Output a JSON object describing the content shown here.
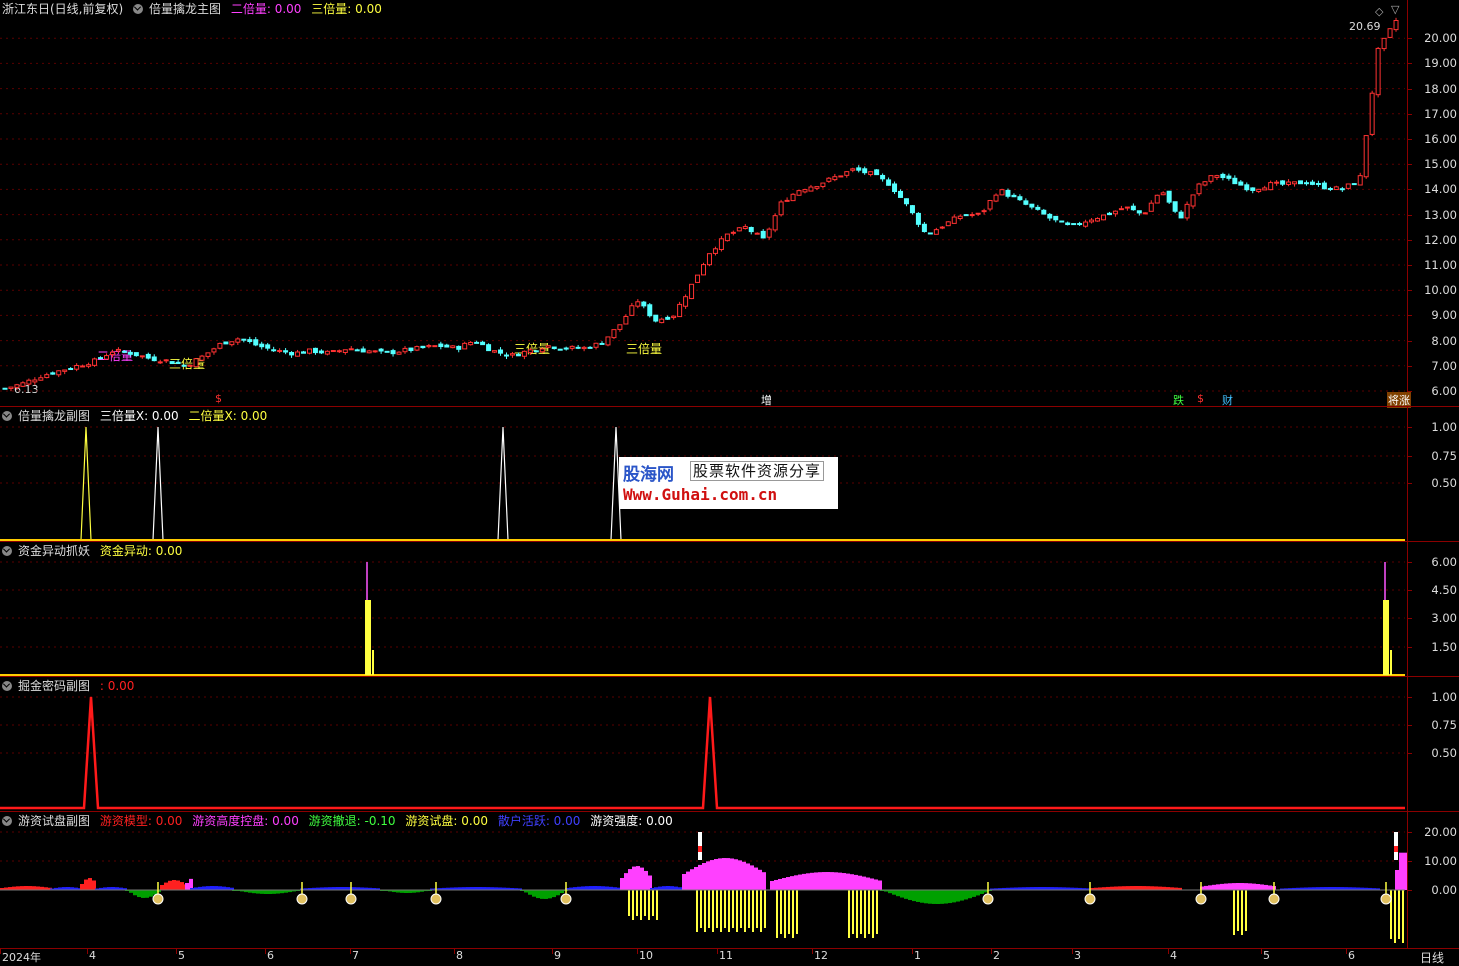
{
  "main_panel": {
    "title": "浙江东日(日线,前复权)",
    "indicator": "倍量擒龙主图",
    "fields": [
      {
        "label": "二倍量: 0.00",
        "color": "#ff40ff"
      },
      {
        "label": "三倍量: 0.00",
        "color": "#ffff40"
      }
    ],
    "high_label": "20.69",
    "low_label": "6.13",
    "y_ticks": [
      "20.00",
      "19.00",
      "18.00",
      "17.00",
      "16.00",
      "15.00",
      "14.00",
      "13.00",
      "12.00",
      "11.00",
      "10.00",
      "9.00",
      "8.00",
      "7.00",
      "6.00"
    ],
    "annotations": [
      {
        "text": "二倍量",
        "color": "#ff40ff"
      },
      {
        "text": "三倍量",
        "color": "#ffff40"
      },
      {
        "text": "三倍量",
        "color": "#ffff40"
      },
      {
        "text": "三倍量",
        "color": "#ffff40"
      }
    ],
    "signals": [
      {
        "text": "$",
        "color": "#ff3030"
      },
      {
        "text": "增",
        "color": "#ffffff"
      },
      {
        "text": "跌",
        "color": "#40ff40"
      },
      {
        "text": "$",
        "color": "#ff3030"
      },
      {
        "text": "财",
        "color": "#40c0ff"
      },
      {
        "text": "将涨",
        "color": "#ffffff"
      }
    ]
  },
  "sub1": {
    "title": "倍量擒龙副图",
    "fields": [
      {
        "label": "三倍量X: 0.00",
        "color": "#ffffff"
      },
      {
        "label": "二倍量X: 0.00",
        "color": "#ffff40"
      }
    ],
    "y_ticks": [
      "1.00",
      "0.75",
      "0.50"
    ]
  },
  "sub2": {
    "title": "资金异动抓妖",
    "fields": [
      {
        "label": "资金异动: 0.00",
        "color": "#ffff40"
      }
    ],
    "y_ticks": [
      "6.00",
      "4.50",
      "3.00",
      "1.50"
    ]
  },
  "sub3": {
    "title": "掘金密码副图",
    "fields": [
      {
        "label": ": 0.00",
        "color": "#ff2020"
      }
    ],
    "y_ticks": [
      "1.00",
      "0.75",
      "0.50"
    ]
  },
  "sub4": {
    "title": "游资试盘副图",
    "fields": [
      {
        "label": "游资模型: 0.00",
        "color": "#ff2020"
      },
      {
        "label": "游资高度控盘: 0.00",
        "color": "#ff40ff"
      },
      {
        "label": "游资撤退: -0.10",
        "color": "#40ff40"
      },
      {
        "label": "游资试盘: 0.00",
        "color": "#ffff40"
      },
      {
        "label": "散户活跃: 0.00",
        "color": "#4040ff"
      },
      {
        "label": "游资强度: 0.00",
        "color": "#ffffff"
      }
    ],
    "y_ticks": [
      "20.00",
      "10.00",
      "0.00"
    ]
  },
  "time_axis": {
    "labels": [
      "2024年",
      "4",
      "5",
      "6",
      "7",
      "8",
      "9",
      "10",
      "11",
      "12",
      "1",
      "2",
      "3",
      "4",
      "5",
      "6"
    ],
    "period": "日线"
  },
  "watermark": {
    "brand": "股海网",
    "slogan": "股票软件资源分享",
    "url": "Www.Guhai.com.cn"
  },
  "chart_data": {
    "type": "candlestick",
    "price_range": [
      5.5,
      21.0
    ],
    "close_series": [
      6.1,
      6.3,
      6.6,
      6.8,
      7.0,
      7.2,
      7.6,
      7.5,
      7.3,
      7.2,
      7.0,
      7.4,
      7.9,
      8.1,
      7.8,
      7.6,
      7.5,
      7.6,
      7.5,
      7.7,
      7.6,
      7.5,
      7.6,
      7.7,
      7.8,
      7.7,
      8.0,
      7.6,
      7.4,
      7.6,
      7.8,
      7.7,
      7.7,
      7.9,
      8.6,
      9.6,
      8.8,
      9.0,
      10.2,
      11.5,
      12.2,
      12.5,
      12.0,
      13.5,
      14.0,
      14.2,
      14.5,
      14.8,
      14.6,
      14.2,
      13.3,
      12.2,
      12.6,
      13.0,
      13.0,
      14.0,
      13.6,
      13.2,
      12.8,
      12.5,
      12.8,
      13.0,
      13.3,
      13.0,
      14.0,
      12.8,
      14.1,
      14.6,
      14.3,
      14.0,
      14.2,
      14.2,
      14.3,
      14.1,
      14.0,
      14.4,
      19.5,
      20.7
    ]
  }
}
